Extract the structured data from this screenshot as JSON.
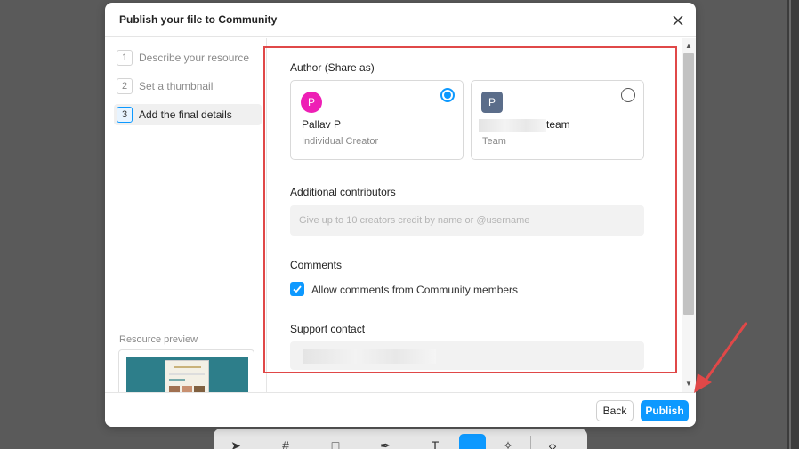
{
  "modal": {
    "title": "Publish your file to Community"
  },
  "steps": [
    {
      "num": "1",
      "label": "Describe your resource"
    },
    {
      "num": "2",
      "label": "Set a thumbnail"
    },
    {
      "num": "3",
      "label": "Add the final details"
    }
  ],
  "sidebar": {
    "preview_label": "Resource preview"
  },
  "author": {
    "section_label": "Author (Share as)",
    "options": [
      {
        "avatar": "P",
        "name": "Pallav P",
        "sub": "Individual Creator",
        "selected": true
      },
      {
        "avatar": "P",
        "name_suffix": "team",
        "sub": "Team",
        "selected": false
      }
    ]
  },
  "contributors": {
    "label": "Additional contributors",
    "placeholder": "Give up to 10 creators credit by name or @username"
  },
  "comments": {
    "label": "Comments",
    "checkbox_label": "Allow comments from Community members",
    "checked": true
  },
  "support": {
    "label": "Support contact"
  },
  "footer": {
    "back_label": "Back",
    "publish_label": "Publish"
  },
  "colors": {
    "accent": "#0d99ff",
    "highlight": "#e04848",
    "avatar_pink": "#ee1fb5",
    "avatar_slate": "#5b6d8a"
  },
  "icons": {
    "close": "close-icon",
    "check": "check-icon",
    "annotation_arrow": "arrow-icon"
  }
}
